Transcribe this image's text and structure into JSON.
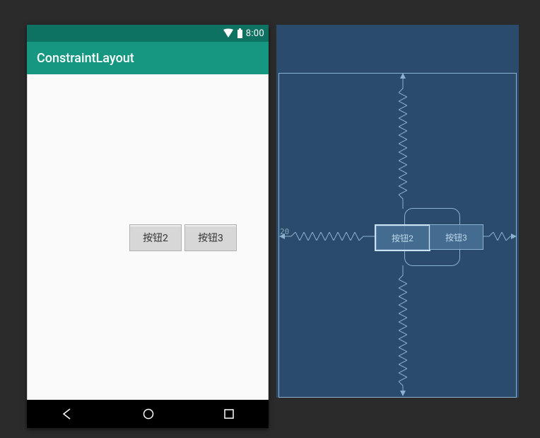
{
  "device": {
    "status": {
      "time": "8:00"
    },
    "action_bar": {
      "title": "ConstraintLayout"
    },
    "buttons": {
      "b2": "按钮2",
      "b3": "按钮3"
    }
  },
  "blueprint": {
    "margin_left_label": "20",
    "buttons": {
      "b2": "按钮2",
      "b3": "按钮3"
    }
  }
}
